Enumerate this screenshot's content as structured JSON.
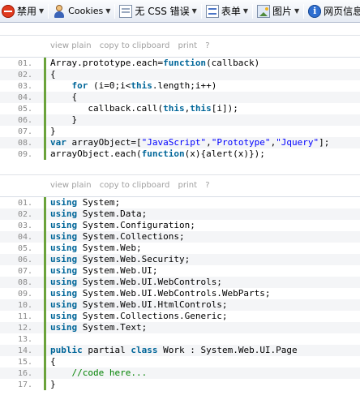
{
  "toolbar": {
    "items": [
      {
        "label": "禁用",
        "icon": "forbid-icon"
      },
      {
        "label": "Cookies",
        "icon": "cookie-icon"
      },
      {
        "label": "无 CSS 错误",
        "icon": "css-icon"
      },
      {
        "label": "表单",
        "icon": "form-icon"
      },
      {
        "label": "图片",
        "icon": "image-icon"
      },
      {
        "label": "网页信息",
        "icon": "info-icon"
      }
    ]
  },
  "panel_toolbar": {
    "view_plain": "view plain",
    "copy": "copy to clipboard",
    "print": "print",
    "help": "?"
  },
  "snippet1": {
    "lines": [
      {
        "num": "01.",
        "indent": "",
        "tokens": [
          [
            "",
            "Array.prototype.each="
          ],
          [
            "kw",
            "function"
          ],
          [
            "",
            "(callback)"
          ]
        ]
      },
      {
        "num": "02.",
        "indent": "",
        "tokens": [
          [
            "",
            "{"
          ]
        ]
      },
      {
        "num": "03.",
        "indent": "    ",
        "tokens": [
          [
            "kw",
            "for"
          ],
          [
            "",
            " (i=0;i<"
          ],
          [
            "kw",
            "this"
          ],
          [
            "",
            ".length;i++)"
          ]
        ]
      },
      {
        "num": "04.",
        "indent": "    ",
        "tokens": [
          [
            "",
            "{"
          ]
        ]
      },
      {
        "num": "05.",
        "indent": "       ",
        "tokens": [
          [
            "",
            "callback.call("
          ],
          [
            "kw",
            "this"
          ],
          [
            "",
            ","
          ],
          [
            "kw",
            "this"
          ],
          [
            "",
            "[i]);"
          ]
        ]
      },
      {
        "num": "06.",
        "indent": "    ",
        "tokens": [
          [
            "",
            "}"
          ]
        ]
      },
      {
        "num": "07.",
        "indent": "",
        "tokens": [
          [
            "",
            "}"
          ]
        ]
      },
      {
        "num": "08.",
        "indent": "",
        "tokens": [
          [
            "kw",
            "var"
          ],
          [
            "",
            " arrayObject=["
          ],
          [
            "str",
            "\"JavaScript\""
          ],
          [
            "",
            ","
          ],
          [
            "str",
            "\"Prototype\""
          ],
          [
            "",
            ","
          ],
          [
            "str",
            "\"Jquery\""
          ],
          [
            "",
            "];"
          ]
        ]
      },
      {
        "num": "09.",
        "indent": "",
        "tokens": [
          [
            "",
            "arrayObject.each("
          ],
          [
            "kw",
            "function"
          ],
          [
            "",
            "(x){alert(x)});"
          ]
        ]
      }
    ]
  },
  "snippet2": {
    "lines": [
      {
        "num": "01.",
        "indent": "",
        "tokens": [
          [
            "kw",
            "using"
          ],
          [
            "",
            " System;"
          ]
        ]
      },
      {
        "num": "02.",
        "indent": "",
        "tokens": [
          [
            "kw",
            "using"
          ],
          [
            "",
            " System.Data;"
          ]
        ]
      },
      {
        "num": "03.",
        "indent": "",
        "tokens": [
          [
            "kw",
            "using"
          ],
          [
            "",
            " System.Configuration;"
          ]
        ]
      },
      {
        "num": "04.",
        "indent": "",
        "tokens": [
          [
            "kw",
            "using"
          ],
          [
            "",
            " System.Collections;"
          ]
        ]
      },
      {
        "num": "05.",
        "indent": "",
        "tokens": [
          [
            "kw",
            "using"
          ],
          [
            "",
            " System.Web;"
          ]
        ]
      },
      {
        "num": "06.",
        "indent": "",
        "tokens": [
          [
            "kw",
            "using"
          ],
          [
            "",
            " System.Web.Security;"
          ]
        ]
      },
      {
        "num": "07.",
        "indent": "",
        "tokens": [
          [
            "kw",
            "using"
          ],
          [
            "",
            " System.Web.UI;"
          ]
        ]
      },
      {
        "num": "08.",
        "indent": "",
        "tokens": [
          [
            "kw",
            "using"
          ],
          [
            "",
            " System.Web.UI.WebControls;"
          ]
        ]
      },
      {
        "num": "09.",
        "indent": "",
        "tokens": [
          [
            "kw",
            "using"
          ],
          [
            "",
            " System.Web.UI.WebControls.WebParts;"
          ]
        ]
      },
      {
        "num": "10.",
        "indent": "",
        "tokens": [
          [
            "kw",
            "using"
          ],
          [
            "",
            " System.Web.UI.HtmlControls;"
          ]
        ]
      },
      {
        "num": "11.",
        "indent": "",
        "tokens": [
          [
            "kw",
            "using"
          ],
          [
            "",
            " System.Collections.Generic;"
          ]
        ]
      },
      {
        "num": "12.",
        "indent": "",
        "tokens": [
          [
            "kw",
            "using"
          ],
          [
            "",
            " System.Text;"
          ]
        ]
      },
      {
        "num": "13.",
        "indent": "",
        "tokens": [
          [
            "",
            ""
          ]
        ]
      },
      {
        "num": "14.",
        "indent": "",
        "tokens": [
          [
            "kw",
            "public"
          ],
          [
            "",
            " partial "
          ],
          [
            "kw",
            "class"
          ],
          [
            "",
            " Work : System.Web.UI.Page"
          ]
        ]
      },
      {
        "num": "15.",
        "indent": "",
        "tokens": [
          [
            "",
            "{"
          ]
        ]
      },
      {
        "num": "16.",
        "indent": "    ",
        "tokens": [
          [
            "cm",
            "//code here..."
          ]
        ]
      },
      {
        "num": "17.",
        "indent": "",
        "tokens": [
          [
            "",
            "}"
          ]
        ]
      }
    ]
  },
  "colors": {
    "keyword": "#006699",
    "string": "#0000ff",
    "comment": "#008200",
    "gutter_bar": "#6ba33b"
  }
}
